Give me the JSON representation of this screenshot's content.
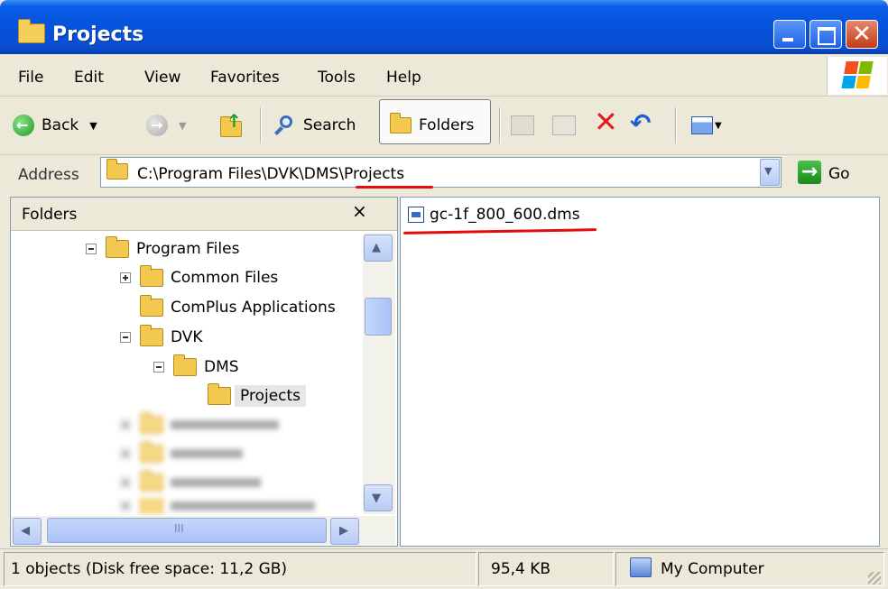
{
  "window": {
    "title": "Projects"
  },
  "menu": [
    "File",
    "Edit",
    "View",
    "Favorites",
    "Tools",
    "Help"
  ],
  "toolbar": {
    "back_label": "Back",
    "search_label": "Search",
    "folders_label": "Folders"
  },
  "address": {
    "label": "Address",
    "path": "C:\\Program Files\\DVK\\DMS\\Projects",
    "go_label": "Go"
  },
  "folders_pane": {
    "title": "Folders",
    "close_label": "×",
    "tree": [
      {
        "label": "Program Files",
        "expander": "minus"
      },
      {
        "label": "Common Files",
        "expander": "plus"
      },
      {
        "label": "ComPlus Applications",
        "expander": "none"
      },
      {
        "label": "DVK",
        "expander": "minus"
      },
      {
        "label": "DMS",
        "expander": "minus"
      },
      {
        "label": "Projects",
        "expander": "none",
        "selected": true
      }
    ],
    "hscroll_mark": "III"
  },
  "files": [
    {
      "name": "gc-1f_800_600.dms",
      "icon": "dms-file-icon"
    }
  ],
  "status": {
    "objects": "1 objects (Disk free space: 11,2 GB)",
    "size": "95,4 KB",
    "location": "My Computer"
  },
  "colors": {
    "titlebar": "#0552db",
    "chrome": "#ece9d8",
    "annotation_red": "#e20c0c"
  }
}
